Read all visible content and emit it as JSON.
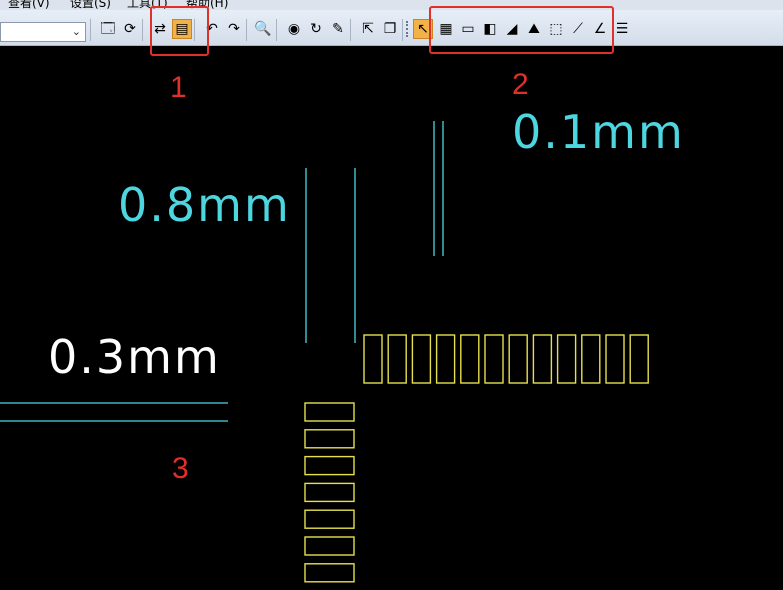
{
  "menubar": {
    "items": [
      {
        "label": "查看(V)"
      },
      {
        "label": "设置(S)"
      },
      {
        "label": "工具(T)"
      },
      {
        "label": "帮助(H)"
      }
    ]
  },
  "toolbar": {
    "combo_value": "",
    "combo_arrow": "⌄",
    "buttons_group_a": [
      {
        "icon": "properties-icon",
        "glyph": "🗔"
      },
      {
        "icon": "refresh-icon",
        "glyph": "⟳"
      },
      {
        "icon": "route-icon",
        "glyph": "⇄"
      },
      {
        "icon": "pcb-layers-icon",
        "glyph": "▤"
      },
      {
        "icon": "undo-icon",
        "glyph": "↶"
      },
      {
        "icon": "redo-icon",
        "glyph": "↷"
      },
      {
        "icon": "zoom-icon",
        "glyph": "🔍"
      },
      {
        "icon": "view-icon",
        "glyph": "◉"
      },
      {
        "icon": "rotate-icon",
        "glyph": "↻"
      },
      {
        "icon": "brush-icon",
        "glyph": "✎"
      },
      {
        "icon": "export-icon",
        "glyph": "⇱"
      },
      {
        "icon": "window-icon",
        "glyph": "❐"
      }
    ],
    "buttons_group_b": [
      {
        "icon": "select-arrow-icon",
        "glyph": "↖"
      },
      {
        "icon": "component-icon",
        "glyph": "▦"
      },
      {
        "icon": "board-outline-icon",
        "glyph": "▭"
      },
      {
        "icon": "pad-icon",
        "glyph": "◧"
      },
      {
        "icon": "copper-area-icon",
        "glyph": "◢"
      },
      {
        "icon": "keepout-icon",
        "glyph": "⛰"
      },
      {
        "icon": "drafting-icon",
        "glyph": "⬚"
      },
      {
        "icon": "dimension-icon",
        "glyph": "⟋"
      },
      {
        "icon": "angle-dimension-icon",
        "glyph": "∠"
      },
      {
        "icon": "list-icon",
        "glyph": "☰"
      }
    ]
  },
  "callouts": {
    "one": "1",
    "two": "2",
    "three": "3"
  },
  "canvas": {
    "labels": {
      "zero_point_one": "0.1mm",
      "zero_point_eight": "0.8mm",
      "zero_point_three": "0.3mm"
    },
    "colors": {
      "background": "#000000",
      "trace_cyan": "#4dd6e0",
      "label_white": "#ffffff",
      "pad_yellow": "#e6e04d",
      "callout_red": "#e0302a"
    },
    "pads": {
      "horizontal_row_count": 12,
      "vertical_column_count": 7
    }
  }
}
